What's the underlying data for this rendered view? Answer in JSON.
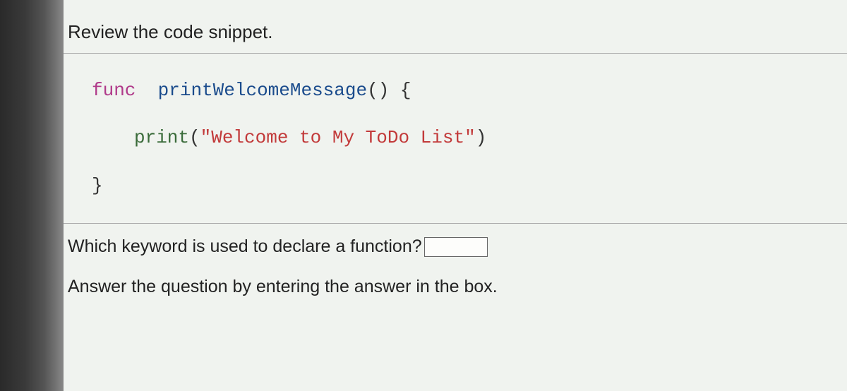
{
  "header": {
    "title": "Review the code snippet."
  },
  "code": {
    "keyword_func": "func",
    "function_name": "printWelcomeMessage",
    "parens": "()",
    "open_brace": " {",
    "print_call": "print",
    "open_paren": "(",
    "string_literal": "\"Welcome to My ToDo List\"",
    "close_paren": ")",
    "close_brace": "}"
  },
  "question": {
    "text": "Which keyword is used to declare a function?",
    "answer_value": ""
  },
  "instruction": {
    "text": "Answer the question by entering the answer in the box."
  }
}
